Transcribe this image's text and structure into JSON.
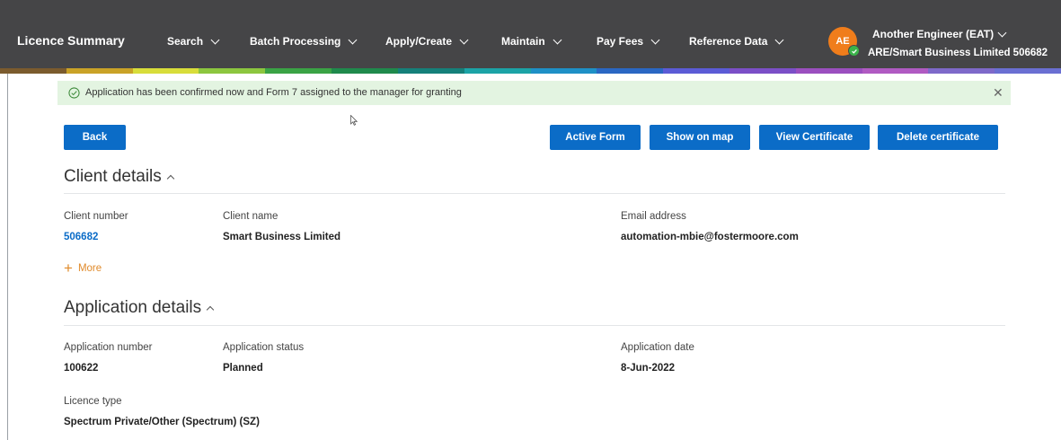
{
  "nav": {
    "brand": "Licence Summary",
    "items": [
      {
        "label": "Search"
      },
      {
        "label": "Batch Processing"
      },
      {
        "label": "Apply/Create"
      },
      {
        "label": "Maintain"
      },
      {
        "label": "Pay Fees"
      },
      {
        "label": "Reference Data"
      }
    ],
    "user": {
      "initials": "AE",
      "name": "Another Engineer (EAT)",
      "org": "ARE/Smart Business Limited 506682"
    },
    "strip_colors": [
      "#7b5b2e",
      "#c9a227",
      "#d8dd3a",
      "#8cc63f",
      "#3aa345",
      "#1f8a4c",
      "#15807a",
      "#1ba3a6",
      "#1e90c6",
      "#2a67c3",
      "#5b5bd6",
      "#7b4fc7",
      "#9b4fbf",
      "#b05ac2",
      "#7e69c9",
      "#6a6fd2"
    ]
  },
  "alert": {
    "text": "Application has been confirmed now and Form 7 assigned to the manager for granting",
    "bg_color": "#e3f4e1"
  },
  "buttons": {
    "back": "Back",
    "active_form": "Active Form",
    "show_on_map": "Show on map",
    "view_certificate": "View Certificate",
    "delete_certificate": "Delete certificate"
  },
  "accent_color": "#0b6cc7",
  "client": {
    "title": "Client details",
    "number_label": "Client number",
    "number": "506682",
    "name_label": "Client name",
    "name": "Smart Business Limited",
    "email_label": "Email address",
    "email": "automation-mbie@fostermoore.com",
    "more_label": "More"
  },
  "application": {
    "title": "Application details",
    "number_label": "Application number",
    "number": "100622",
    "status_label": "Application status",
    "status": "Planned",
    "date_label": "Application date",
    "date": "8-Jun-2022",
    "licence_type_label": "Licence type",
    "licence_type": "Spectrum Private/Other (Spectrum) (SZ)"
  }
}
